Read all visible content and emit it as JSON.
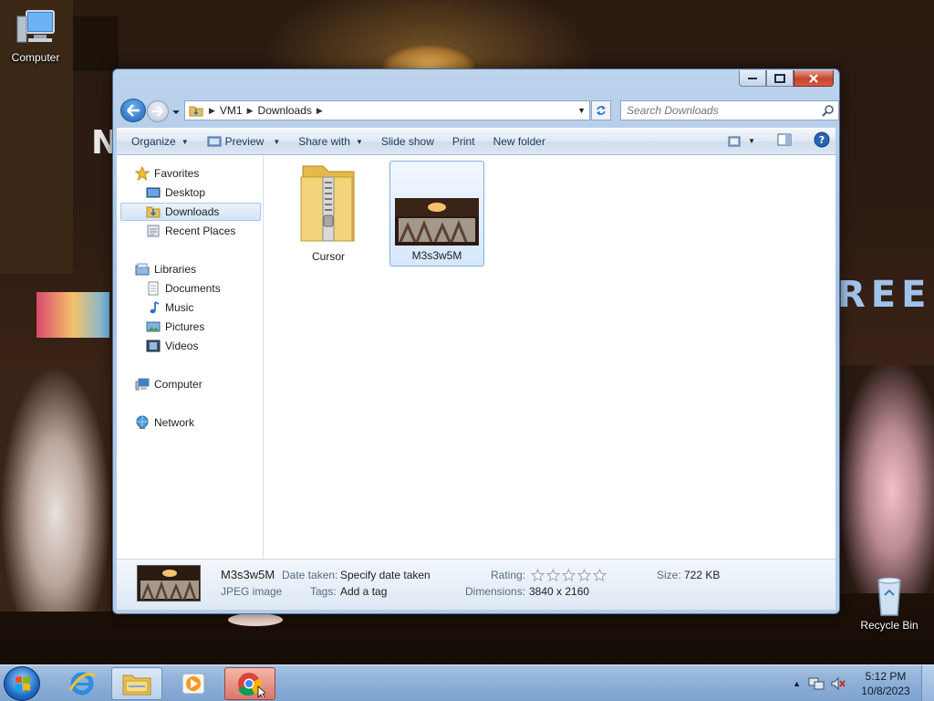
{
  "desktop": {
    "icons": [
      {
        "label": "Computer"
      },
      {
        "label": "Recycle Bin"
      }
    ],
    "wallpaper_text_right": "REE",
    "wallpaper_text_left": "N"
  },
  "window": {
    "address": {
      "crumbs": [
        "VM1",
        "Downloads"
      ],
      "search_placeholder": "Search Downloads"
    },
    "toolbar": {
      "organize": "Organize",
      "preview": "Preview",
      "share_with": "Share with",
      "slide_show": "Slide show",
      "print": "Print",
      "new_folder": "New folder"
    },
    "nav": {
      "favorites": "Favorites",
      "desktop": "Desktop",
      "downloads": "Downloads",
      "recent_places": "Recent Places",
      "libraries": "Libraries",
      "documents": "Documents",
      "music": "Music",
      "pictures": "Pictures",
      "videos": "Videos",
      "computer": "Computer",
      "network": "Network"
    },
    "files": [
      {
        "name": "Cursor",
        "type": "zip-folder"
      },
      {
        "name": "M3s3w5M",
        "type": "image",
        "selected": true
      }
    ],
    "details": {
      "name": "M3s3w5M",
      "type": "JPEG image",
      "date_taken_label": "Date taken:",
      "date_taken_value": "Specify date taken",
      "tags_label": "Tags:",
      "tags_value": "Add a tag",
      "rating_label": "Rating:",
      "rating_stars": 0,
      "dimensions_label": "Dimensions:",
      "dimensions_value": "3840 x 2160",
      "size_label": "Size:",
      "size_value": "722 KB"
    }
  },
  "taskbar": {
    "time": "5:12 PM",
    "date": "10/8/2023"
  },
  "colors": {
    "selection_fill": "#d6e8fc",
    "selection_border": "#84acdd",
    "taskbar": "#8fb0d8"
  }
}
